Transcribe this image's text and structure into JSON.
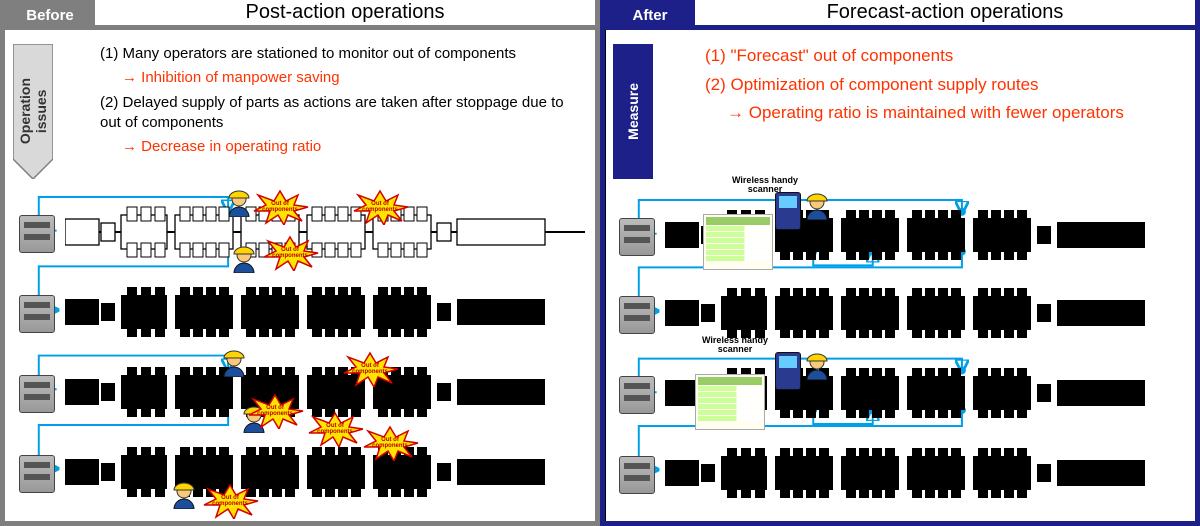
{
  "left": {
    "badge": "Before",
    "title": "Post-action operations",
    "sideTag": "Operation\nissues",
    "bullets": {
      "b1": "(1) Many operators are stationed to monitor out of components",
      "b1r": "→ Inhibition of manpower saving",
      "b2": "(2) Delayed supply of parts as actions are taken after stoppage due to out of components",
      "b2r": "→ Decrease in operating ratio"
    },
    "burst_label": "Out of\ncomponents"
  },
  "right": {
    "badge": "After",
    "title": "Forecast-action operations",
    "sideTag": "Measure",
    "bullets": {
      "b1": "(1) \"Forecast\" out of components",
      "b2": "(2) Optimization of component supply routes",
      "b2r": "→ Operating ratio is maintained with fewer operators"
    },
    "scanner_label": "Wireless handy\nscanner"
  }
}
